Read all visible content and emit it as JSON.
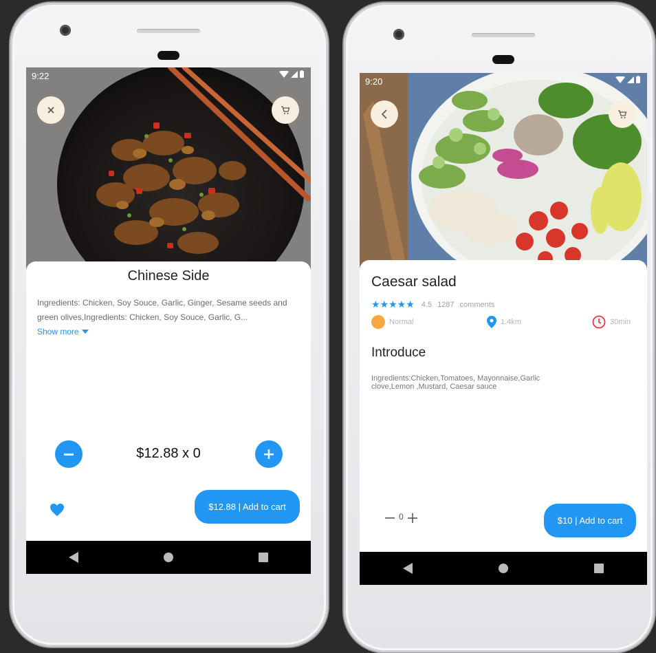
{
  "left": {
    "status": {
      "time": "9:22"
    },
    "icons": {
      "close": "close-icon",
      "cart": "cart-icon"
    },
    "product": {
      "title": "Chinese Side",
      "description": "Ingredients: Chicken, Soy Souce, Garlic, Ginger, Sesame seeds and green olives,Ingredients: Chicken, Soy Souce, Garlic, G...",
      "show_more": "Show more"
    },
    "quantity": {
      "minus": "−",
      "plus": "+",
      "price_qty": "$12.88 x 0",
      "value": 0
    },
    "favorite_icon": "heart-icon",
    "add_to_cart": "$12.88 | Add to cart"
  },
  "right": {
    "status": {
      "time": "9:20"
    },
    "icons": {
      "back": "back-icon",
      "cart": "cart-icon"
    },
    "product": {
      "title": "Caesar salad",
      "stars": "★★★★★",
      "rating": "4.5",
      "comments_count": "1287",
      "comments_label": "comments",
      "difficulty": "Normal",
      "distance": "1.4km",
      "time": "30min",
      "section_title": "Introduce",
      "description": "Ingredients:Chicken,Tomatoes, Mayonnaise,Garlic clove,Lemon ,Mustard, Caesar sauce"
    },
    "quantity": {
      "minus": "—",
      "value": "0",
      "plus": "+"
    },
    "add_to_cart": "$10 | Add to cart"
  },
  "colors": {
    "accent": "#2196f3",
    "orange": "#f5a742",
    "red": "#e53935",
    "cream": "#f8efe0"
  }
}
